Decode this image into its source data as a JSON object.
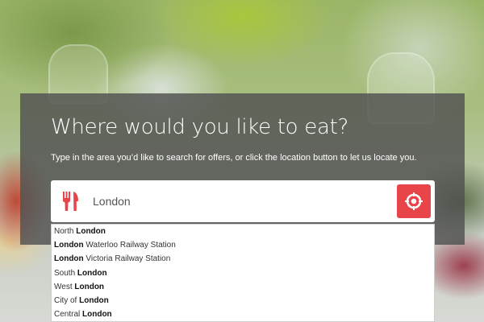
{
  "hero": {
    "title": "Where would you like to eat?",
    "subtitle": "Type in the area you’d like to search for offers, or click the location button to let us locate you."
  },
  "search": {
    "value": "London",
    "left_icon": "fork-knife-icon",
    "locate_icon": "crosshair-icon",
    "accent_color": "#e8454a"
  },
  "suggestions": [
    {
      "before": "North ",
      "match": "London",
      "after": ""
    },
    {
      "before": "",
      "match": "London",
      "after": " Waterloo Railway Station"
    },
    {
      "before": "",
      "match": "London",
      "after": " Victoria Railway Station"
    },
    {
      "before": "South ",
      "match": "London",
      "after": ""
    },
    {
      "before": "West ",
      "match": "London",
      "after": ""
    },
    {
      "before": "City of ",
      "match": "London",
      "after": ""
    },
    {
      "before": "Central ",
      "match": "London",
      "after": ""
    }
  ]
}
